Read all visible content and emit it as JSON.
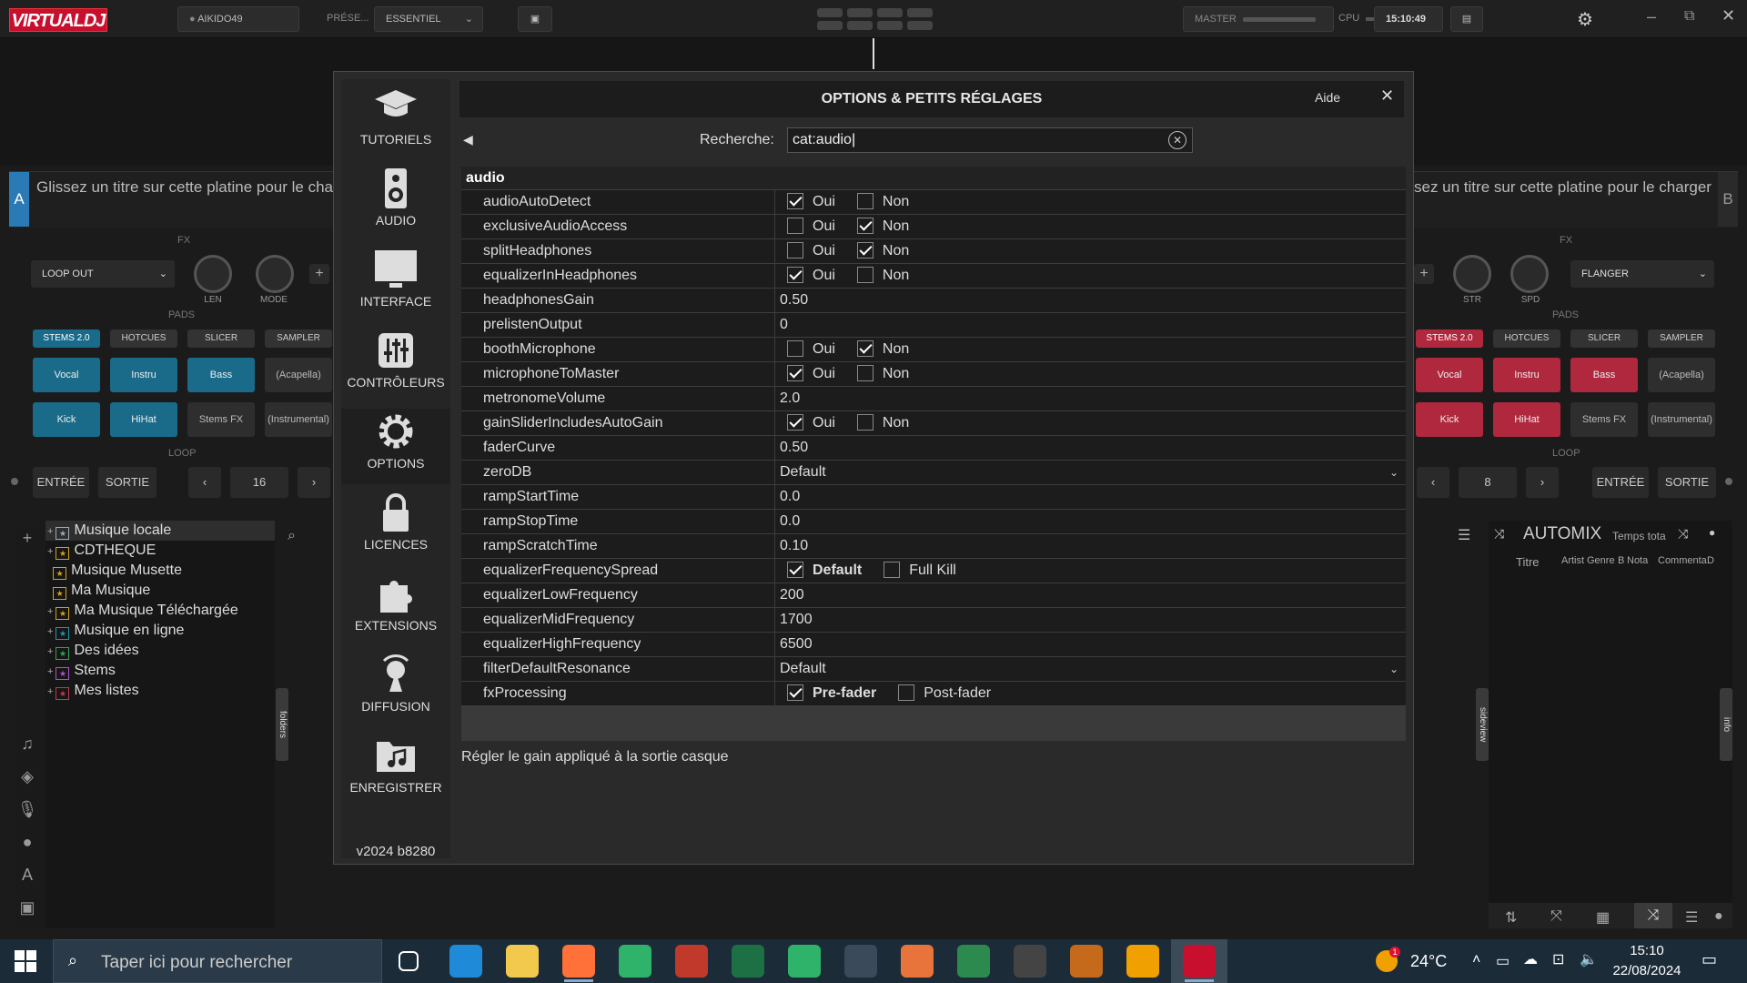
{
  "top": {
    "logo": "VIRTUALDJ",
    "user": "AIKIDO49",
    "preset_label": "PRÉSE...",
    "preset_value": "ESSENTIEL",
    "master_label": "MASTER",
    "cpu_label": "CPU",
    "clock": "15:10:49"
  },
  "deck_a": {
    "letter": "A",
    "drop_text": "Glissez un titre sur cette platine pour le cha",
    "fx_label": "FX",
    "fx_select": "LOOP OUT",
    "knob1": "LEN",
    "knob2": "MODE",
    "pads_label": "PADS",
    "tabs": [
      "STEMS 2.0",
      "HOTCUES",
      "SLICER",
      "SAMPLER"
    ],
    "pads_row1": [
      "Vocal",
      "Instru",
      "Bass",
      "(Acapella)"
    ],
    "pads_row2": [
      "Kick",
      "HiHat",
      "Stems FX",
      "(Instrumental)"
    ],
    "loop_label": "LOOP",
    "entree": "ENTRÉE",
    "sortie": "SORTIE",
    "loop_value": "16"
  },
  "deck_b": {
    "letter": "B",
    "drop_text": "sez un titre sur cette platine pour le charger",
    "fx_label": "FX",
    "fx_select": "FLANGER",
    "knob1": "STR",
    "knob2": "SPD",
    "pads_label": "PADS",
    "tabs": [
      "STEMS 2.0",
      "HOTCUES",
      "SLICER",
      "SAMPLER"
    ],
    "pads_row1": [
      "Vocal",
      "Instru",
      "Bass",
      "(Acapella)"
    ],
    "pads_row2": [
      "Kick",
      "HiHat",
      "Stems FX",
      "(Instrumental)"
    ],
    "loop_label": "LOOP",
    "entree": "ENTRÉE",
    "sortie": "SORTIE",
    "loop_value": "8"
  },
  "browser": {
    "tree": [
      "Musique locale",
      "CDTHEQUE",
      "Musique Musette",
      "Ma Musique",
      "Ma Musique Téléchargée",
      "Musique en ligne",
      "Des idées",
      "Stems",
      "Mes listes"
    ],
    "folders_tab": "folders",
    "sideview_tab": "sideview",
    "info_tab": "info",
    "automix_title": "AUTOMIX",
    "automix_time": "Temps tota",
    "automix_cols": [
      "Titre",
      "Artist",
      "Genre",
      "B",
      "Nota",
      "Commenta",
      "D"
    ]
  },
  "dialog": {
    "title": "OPTIONS & PETITS RÉGLAGES",
    "help": "Aide",
    "search_label": "Recherche:",
    "search_value": "cat:audio",
    "version": "v2024 b8280",
    "description": "Régler le gain appliqué à la sortie casque",
    "nav": [
      {
        "label": "TUTORIELS",
        "icon": "graduation-cap-icon"
      },
      {
        "label": "AUDIO",
        "icon": "speaker-icon"
      },
      {
        "label": "INTERFACE",
        "icon": "monitor-icon"
      },
      {
        "label": "CONTRÔLEURS",
        "icon": "sliders-icon"
      },
      {
        "label": "OPTIONS",
        "icon": "gear-icon"
      },
      {
        "label": "LICENCES",
        "icon": "lock-icon"
      },
      {
        "label": "EXTENSIONS",
        "icon": "puzzle-icon"
      },
      {
        "label": "DIFFUSION",
        "icon": "broadcast-icon"
      },
      {
        "label": "ENREGISTRER",
        "icon": "music-folder-icon"
      }
    ],
    "category": "audio",
    "rows": [
      {
        "key": "audioAutoDetect",
        "type": "bool",
        "a": "Oui",
        "b": "Non",
        "va": true,
        "vb": false
      },
      {
        "key": "exclusiveAudioAccess",
        "type": "bool",
        "a": "Oui",
        "b": "Non",
        "va": false,
        "vb": true
      },
      {
        "key": "splitHeadphones",
        "type": "bool",
        "a": "Oui",
        "b": "Non",
        "va": false,
        "vb": true
      },
      {
        "key": "equalizerInHeadphones",
        "type": "bool",
        "a": "Oui",
        "b": "Non",
        "va": true,
        "vb": false
      },
      {
        "key": "headphonesGain",
        "type": "text",
        "value": "0.50"
      },
      {
        "key": "prelistenOutput",
        "type": "text",
        "value": "0"
      },
      {
        "key": "boothMicrophone",
        "type": "bool",
        "a": "Oui",
        "b": "Non",
        "va": false,
        "vb": true
      },
      {
        "key": "microphoneToMaster",
        "type": "bool",
        "a": "Oui",
        "b": "Non",
        "va": true,
        "vb": false
      },
      {
        "key": "metronomeVolume",
        "type": "text",
        "value": "2.0"
      },
      {
        "key": "gainSliderIncludesAutoGain",
        "type": "bool",
        "a": "Oui",
        "b": "Non",
        "va": true,
        "vb": false
      },
      {
        "key": "faderCurve",
        "type": "text",
        "value": "0.50"
      },
      {
        "key": "zeroDB",
        "type": "select",
        "value": "Default"
      },
      {
        "key": "rampStartTime",
        "type": "text",
        "value": "0.0"
      },
      {
        "key": "rampStopTime",
        "type": "text",
        "value": "0.0"
      },
      {
        "key": "rampScratchTime",
        "type": "text",
        "value": "0.10"
      },
      {
        "key": "equalizerFrequencySpread",
        "type": "bool",
        "a": "Default",
        "b": "Full Kill",
        "va": true,
        "vb": false,
        "bold": true
      },
      {
        "key": "equalizerLowFrequency",
        "type": "text",
        "value": "200"
      },
      {
        "key": "equalizerMidFrequency",
        "type": "text",
        "value": "1700"
      },
      {
        "key": "equalizerHighFrequency",
        "type": "text",
        "value": "6500"
      },
      {
        "key": "filterDefaultResonance",
        "type": "select",
        "value": "Default"
      },
      {
        "key": "fxProcessing",
        "type": "bool",
        "a": "Pre-fader",
        "b": "Post-fader",
        "va": true,
        "vb": false,
        "bold": true
      }
    ]
  },
  "taskbar": {
    "search_placeholder": "Taper ici pour rechercher",
    "temp": "24°C",
    "time": "15:10",
    "date": "22/08/2024",
    "weather_badge": "1"
  }
}
